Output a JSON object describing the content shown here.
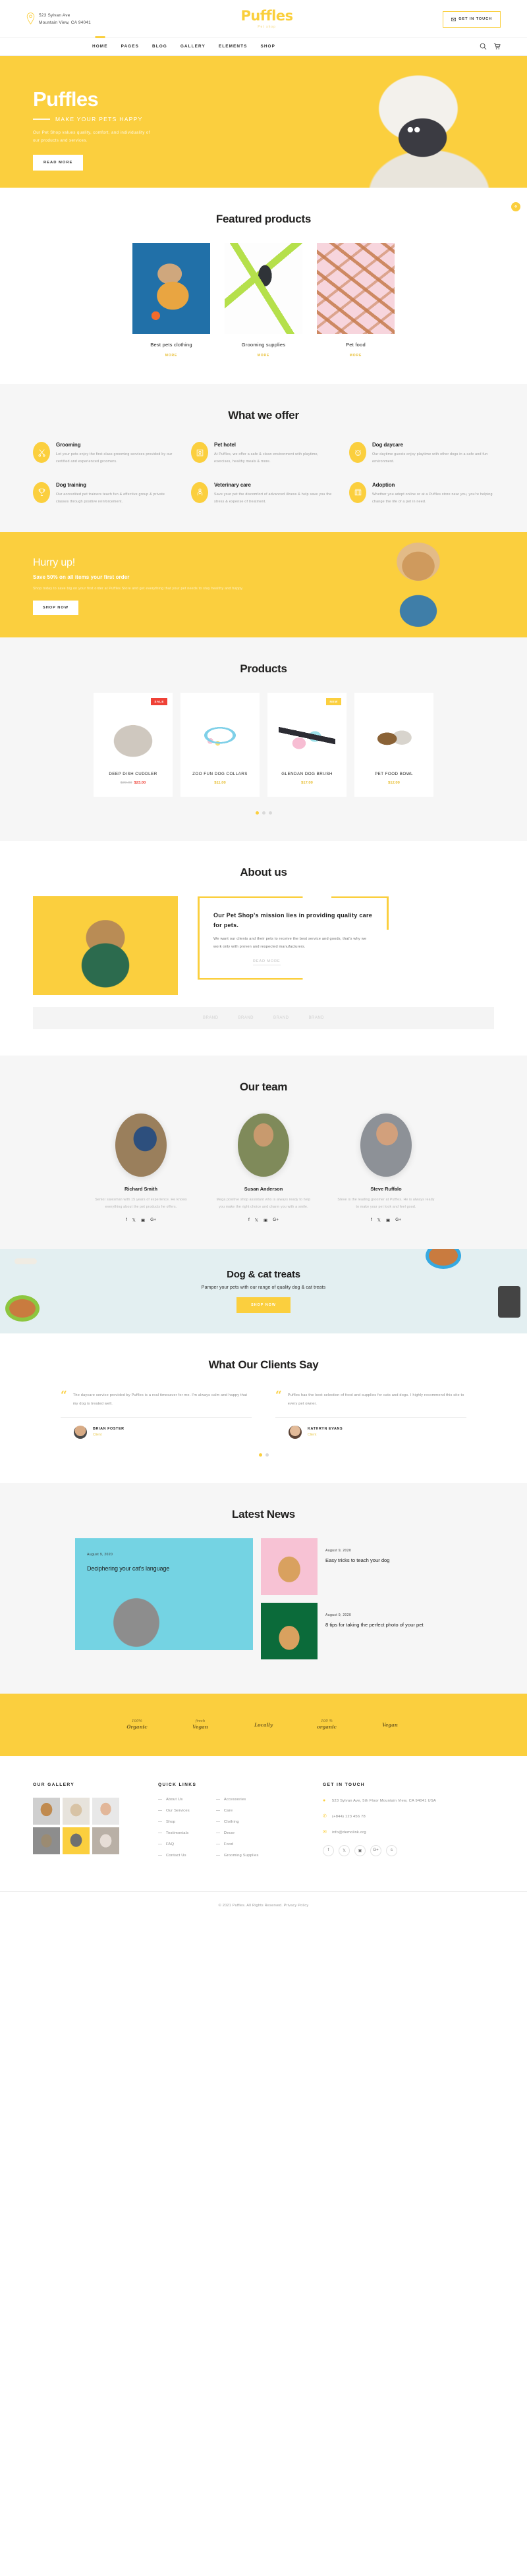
{
  "header": {
    "address_line1": "523 Sylvan Ave",
    "address_line2": "Mountain View, CA 94041",
    "brand_name": "Puffles",
    "brand_sub": "Pet shop",
    "cta_label": "GET IN TOUCH",
    "nav": [
      {
        "label": "HOME",
        "active": true
      },
      {
        "label": "PAGES",
        "active": false
      },
      {
        "label": "BLOG",
        "active": false
      },
      {
        "label": "GALLERY",
        "active": false
      },
      {
        "label": "ELEMENTS",
        "active": false
      },
      {
        "label": "SHOP",
        "active": false
      }
    ]
  },
  "hero": {
    "title": "Puffles",
    "subtitle": "MAKE YOUR PETS HAPPY",
    "description": "Our Pet Shop values quality, comfort, and individuality of our products and services.",
    "button": "READ MORE"
  },
  "featured": {
    "title": "Featured products",
    "more_label": "MORE",
    "items": [
      {
        "name": "Best pets clothing"
      },
      {
        "name": "Grooming supplies"
      },
      {
        "name": "Pet food"
      }
    ]
  },
  "offers": {
    "title": "What we offer",
    "items": [
      {
        "icon": "scissors-icon",
        "title": "Grooming",
        "desc": "Let your pets enjoy the first-class grooming services provided by our certified and experienced groomers."
      },
      {
        "icon": "pet-hotel-icon",
        "title": "Pet hotel",
        "desc": "At Puffles, we offer a safe & clean environment with playtime, exercises, healthy meals & more."
      },
      {
        "icon": "dog-face-icon",
        "title": "Dog daycare",
        "desc": "Our daytime guests enjoy playtime with other dogs in a safe and fun environment."
      },
      {
        "icon": "trophy-icon",
        "title": "Dog training",
        "desc": "Our accredited pet trainers teach fun & effective group & private classes through positive reinforcement."
      },
      {
        "icon": "vet-icon",
        "title": "Veterinary care",
        "desc": "Save your pet the discomfort of advanced illness & help save you the stress & expense of treatment."
      },
      {
        "icon": "cage-icon",
        "title": "Adoption",
        "desc": "Whether you adopt online or at a Puffles store near you, you're helping change the life of a pet in need."
      }
    ]
  },
  "hurry": {
    "title": "Hurry up!",
    "subtitle": "Save 50% on all items your first order",
    "description": "Shop today to save big on your first order at Puffles Store and get everything that your pet needs to stay healthy and happy.",
    "button": "SHOP NOW"
  },
  "products": {
    "title": "Products",
    "items": [
      {
        "badge": "SALE",
        "badge_type": "sale",
        "name": "DEEP DISH CUDDLER",
        "old_price": "$30.00",
        "price": "$23.00",
        "on_sale": true
      },
      {
        "badge": "",
        "badge_type": "",
        "name": "ZOO FUN DOG COLLARS",
        "old_price": "",
        "price": "$11.00",
        "on_sale": false
      },
      {
        "badge": "NEW",
        "badge_type": "new",
        "name": "GLENDAN DOG BRUSH",
        "old_price": "",
        "price": "$17.00",
        "on_sale": false
      },
      {
        "badge": "",
        "badge_type": "",
        "name": "PET FOOD BOWL",
        "old_price": "",
        "price": "$12.00",
        "on_sale": false
      }
    ],
    "dots": 3,
    "active_dot": 0
  },
  "about": {
    "title": "About us",
    "heading": "Our Pet Shop's mission lies in providing quality care for pets.",
    "paragraph": "We want our clients and their pets to receive the best service and goods, that's why we work only with proven and respected manufacturers.",
    "more_label": "READ MORE",
    "partners": [
      "BRAND",
      "BRAND",
      "BRAND",
      "BRAND"
    ]
  },
  "team": {
    "title": "Our team",
    "members": [
      {
        "name": "Richard Smith",
        "desc": "Senior salesman with 15 years of experience. He knows everything about the pet products he offers.",
        "socials": [
          "f",
          "t",
          "in",
          "G+"
        ]
      },
      {
        "name": "Susan Anderson",
        "desc": "Mega positive shop assistant who is always ready to help you make the right choice and charm you with a smile.",
        "socials": [
          "f",
          "t",
          "in",
          "G+"
        ]
      },
      {
        "name": "Steve Ruffalo",
        "desc": "Steve is the leading groomer at Puffles. He is always ready to make your pet look and feel good.",
        "socials": [
          "f",
          "t",
          "in",
          "G+"
        ]
      }
    ]
  },
  "treats": {
    "title": "Dog & cat treats",
    "subtitle": "Pamper your pets with our range of quality dog & cat treats",
    "button": "SHOP NOW"
  },
  "testimonials": {
    "title": "What Our Clients Say",
    "items": [
      {
        "quote": "The daycare service provided by Puffles is a real timesaver for me. I'm always calm and happy that my dog is treated well.",
        "name": "BRIAN FOSTER",
        "role": "Client"
      },
      {
        "quote": "Puffles has the best selection of food and supplies for cats and dogs. I highly recommend this site to every pet owner.",
        "name": "KATHRYN EVANS",
        "role": "Client"
      }
    ],
    "dots": 2,
    "active_dot": 0
  },
  "news": {
    "title": "Latest News",
    "featured": {
      "date": "August 9, 2020",
      "title": "Deciphering your cat's language"
    },
    "items": [
      {
        "date": "August 9, 2020",
        "title": "Easy tricks to teach your dog"
      },
      {
        "date": "August 9, 2020",
        "title": "8 tips for taking the perfect photo of your pet"
      }
    ]
  },
  "brands": [
    {
      "top": "100%",
      "main": "Organic"
    },
    {
      "top": "fresh",
      "main": "Vegan"
    },
    {
      "top": "",
      "main": "Locally"
    },
    {
      "top": "100 %",
      "main": "organic"
    },
    {
      "top": "",
      "main": "Vegan"
    }
  ],
  "footer": {
    "gallery_title": "OUR GALLERY",
    "quick_links_title": "QUICK LINKS",
    "touch_title": "GET IN TOUCH",
    "links_col1": [
      "About Us",
      "Our Services",
      "Shop",
      "Testimonials",
      "FAQ",
      "Contact Us"
    ],
    "links_col2": [
      "Accessories",
      "Care",
      "Clothing",
      "Decor",
      "Food",
      "Grooming Supplies"
    ],
    "address": "523 Sylvan Ave, 5th Floor Mountain View, CA 94041 USA",
    "phone": "(+844) 123 456 78",
    "email": "info@demolink.org",
    "socials": [
      "f",
      "t",
      "in",
      "G+",
      "s"
    ],
    "copyright": "© 2021 Puffles. All Rights Reserved.",
    "privacy": "Privacy Policy"
  },
  "colors": {
    "accent": "#fbcf3e",
    "sale": "#ef4136",
    "treats_bg": "#e3eff1",
    "news_bg": "#74d3e3"
  }
}
